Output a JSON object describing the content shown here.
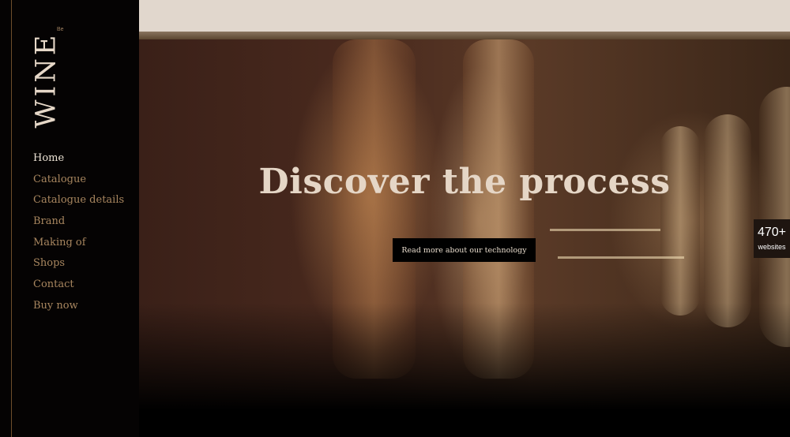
{
  "brand": {
    "logo_text": "WINE",
    "logo_mark": "Be"
  },
  "nav": {
    "items": [
      {
        "label": "Home",
        "active": true
      },
      {
        "label": "Catalogue"
      },
      {
        "label": "Catalogue details"
      },
      {
        "label": "Brand"
      },
      {
        "label": "Making of"
      },
      {
        "label": "Shops"
      },
      {
        "label": "Contact"
      },
      {
        "label": "Buy now"
      }
    ]
  },
  "hero": {
    "title": "Discover the process",
    "cta_label": "Read more about our technology"
  },
  "badge": {
    "count": "470+",
    "label": "websites"
  },
  "colors": {
    "sidebar_bg": "#050303",
    "nav_active": "#ece2d4",
    "nav_link": "#a8865f",
    "top_strip": "#e1d7cd"
  }
}
